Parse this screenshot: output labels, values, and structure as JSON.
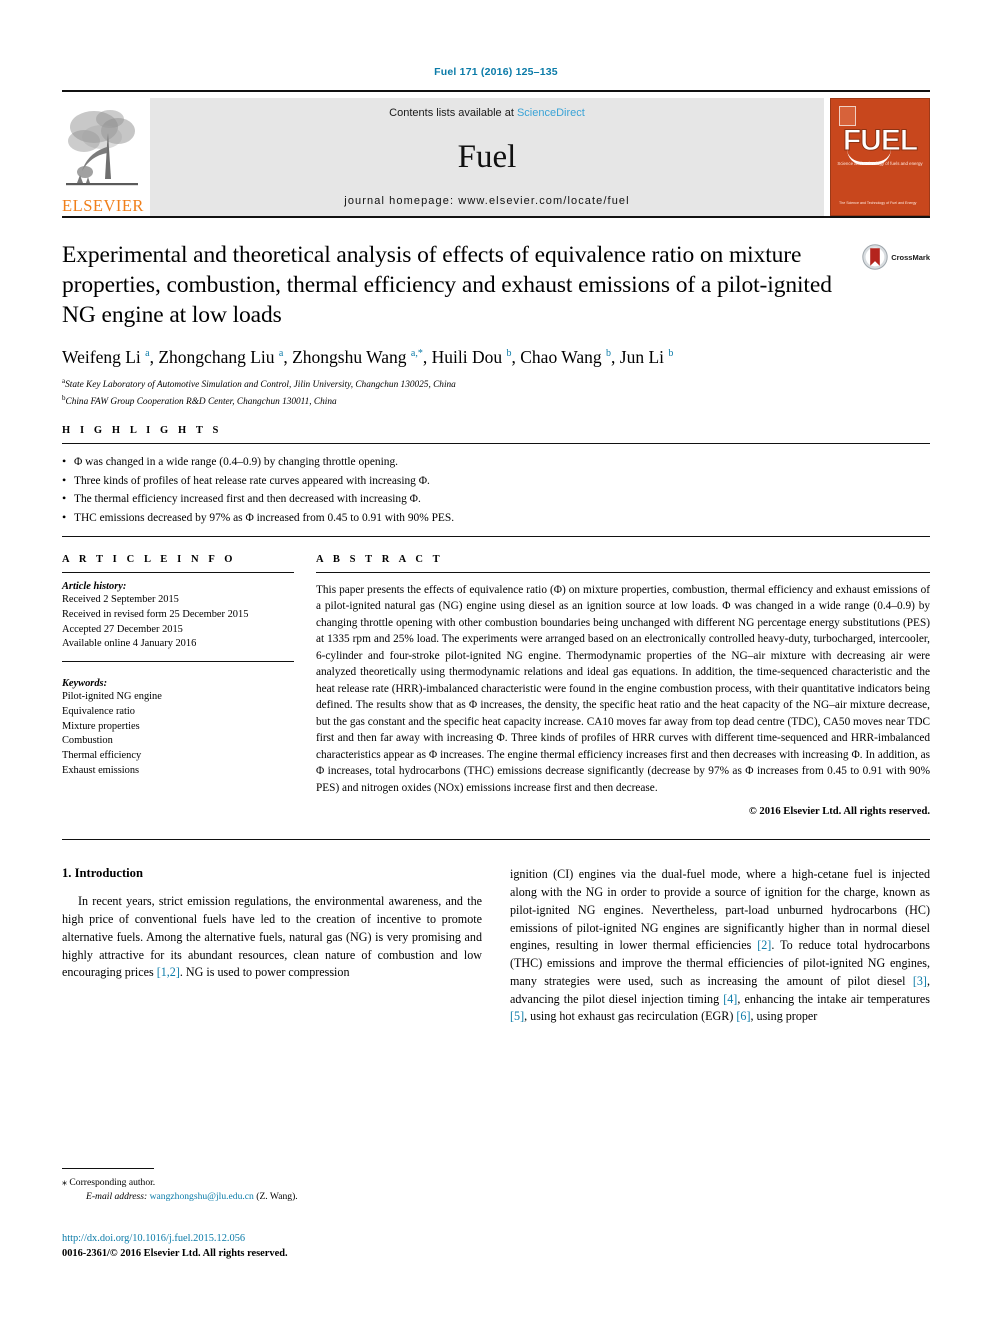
{
  "running_head": "Fuel 171 (2016) 125–135",
  "masthead": {
    "publisher_name": "ELSEVIER",
    "contents_prefix": "Contents lists available at",
    "contents_link": "ScienceDirect",
    "journal_name": "Fuel",
    "homepage": "journal homepage: www.elsevier.com/locate/fuel",
    "cover": {
      "wordmark": "FUEL",
      "subtitle": "Science and technology of fuels and energy",
      "footer": "The Science and Technology\nof Fuel and Energy"
    }
  },
  "article": {
    "title": "Experimental and theoretical analysis of effects of equivalence ratio on mixture properties, combustion, thermal efficiency and exhaust emissions of a pilot-ignited NG engine at low loads",
    "crossmark_label": "CrossMark",
    "authors_html": "Weifeng Li <sup>a</sup>, Zhongchang Liu <sup>a</sup>, Zhongshu Wang <sup>a,*</sup>, Huili Dou <sup>b</sup>, Chao Wang <sup>b</sup>, Jun Li <sup>b</sup>",
    "affiliations": [
      {
        "marker": "a",
        "text": "State Key Laboratory of Automotive Simulation and Control, Jilin University, Changchun 130025, China"
      },
      {
        "marker": "b",
        "text": "China FAW Group Cooperation R&D Center, Changchun 130011, China"
      }
    ]
  },
  "highlights": {
    "heading": "H I G H L I G H T S",
    "items": [
      "Φ was changed in a wide range (0.4–0.9) by changing throttle opening.",
      "Three kinds of profiles of heat release rate curves appeared with increasing Φ.",
      "The thermal efficiency increased first and then decreased with increasing Φ.",
      "THC emissions decreased by 97% as Φ increased from 0.45 to 0.91 with 90% PES."
    ]
  },
  "article_info": {
    "heading": "A R T I C L E    I N F O",
    "history_title": "Article history:",
    "history": [
      "Received 2 September 2015",
      "Received in revised form 25 December 2015",
      "Accepted 27 December 2015",
      "Available online 4 January 2016"
    ],
    "keywords_title": "Keywords:",
    "keywords": [
      "Pilot-ignited NG engine",
      "Equivalence ratio",
      "Mixture properties",
      "Combustion",
      "Thermal efficiency",
      "Exhaust emissions"
    ]
  },
  "abstract": {
    "heading": "A B S T R A C T",
    "text": "This paper presents the effects of equivalence ratio (Φ) on mixture properties, combustion, thermal efficiency and exhaust emissions of a pilot-ignited natural gas (NG) engine using diesel as an ignition source at low loads. Φ was changed in a wide range (0.4–0.9) by changing throttle opening with other combustion boundaries being unchanged with different NG percentage energy substitutions (PES) at 1335 rpm and 25% load. The experiments were arranged based on an electronically controlled heavy-duty, turbocharged, intercooler, 6-cylinder and four-stroke pilot-ignited NG engine. Thermodynamic properties of the NG–air mixture with decreasing air were analyzed theoretically using thermodynamic relations and ideal gas equations. In addition, the time-sequenced characteristic and the heat release rate (HRR)-imbalanced characteristic were found in the engine combustion process, with their quantitative indicators being defined. The results show that as Φ increases, the density, the specific heat ratio and the heat capacity of the NG–air mixture decrease, but the gas constant and the specific heat capacity increase. CA10 moves far away from top dead centre (TDC), CA50 moves near TDC first and then far away with increasing Φ. Three kinds of profiles of HRR curves with different time-sequenced and HRR-imbalanced characteristics appear as Φ increases. The engine thermal efficiency increases first and then decreases with increasing Φ. In addition, as Φ increases, total hydrocarbons (THC) emissions decrease significantly (decrease by 97% as Φ increases from 0.45 to 0.91 with 90% PES) and nitrogen oxides (NOx) emissions increase first and then decrease.",
    "copyright": "© 2016 Elsevier Ltd. All rights reserved."
  },
  "introduction": {
    "heading": "1. Introduction",
    "left_paragraph_html": "In recent years, strict emission regulations, the environmental awareness, and the high price of conventional fuels have led to the creation of incentive to promote alternative fuels. Among the alternative fuels, natural gas (NG) is very promising and highly attractive for its abundant resources, clean nature of combustion and low encouraging prices <span class=\"ref\">[1,2]</span>. NG is used to power compression",
    "right_paragraph_html": "ignition (CI) engines via the dual-fuel mode, where a high-cetane fuel is injected along with the NG in order to provide a source of ignition for the charge, known as pilot-ignited NG engines. Nevertheless, part-load unburned hydrocarbons (HC) emissions of pilot-ignited NG engines are significantly higher than in normal diesel engines, resulting in lower thermal efficiencies <span class=\"ref\">[2]</span>. To reduce total hydrocarbons (THC) emissions and improve the thermal efficiencies of pilot-ignited NG engines, many strategies were used, such as increasing the amount of pilot diesel <span class=\"ref\">[3]</span>, advancing the pilot diesel injection timing <span class=\"ref\">[4]</span>, enhancing the intake air temperatures <span class=\"ref\">[5]</span>, using hot exhaust gas recirculation (EGR) <span class=\"ref\">[6]</span>, using proper"
  },
  "footnote": {
    "corresponding_star": "⁎",
    "corresponding_text": "Corresponding author.",
    "email_label": "E-mail address:",
    "email": "wangzhongshu@jlu.edu.cn",
    "email_owner": "(Z. Wang)."
  },
  "page_footer": {
    "doi": "http://dx.doi.org/10.1016/j.fuel.2015.12.056",
    "issn_line": "0016-2361/© 2016 Elsevier Ltd. All rights reserved."
  },
  "colors": {
    "link_blue": "#0b7ba8",
    "sciencedirect_blue": "#3aa3d6",
    "elsevier_orange": "#f07f1a",
    "cover_orange": "#c8471d",
    "masthead_grey": "#e6e6e6"
  }
}
